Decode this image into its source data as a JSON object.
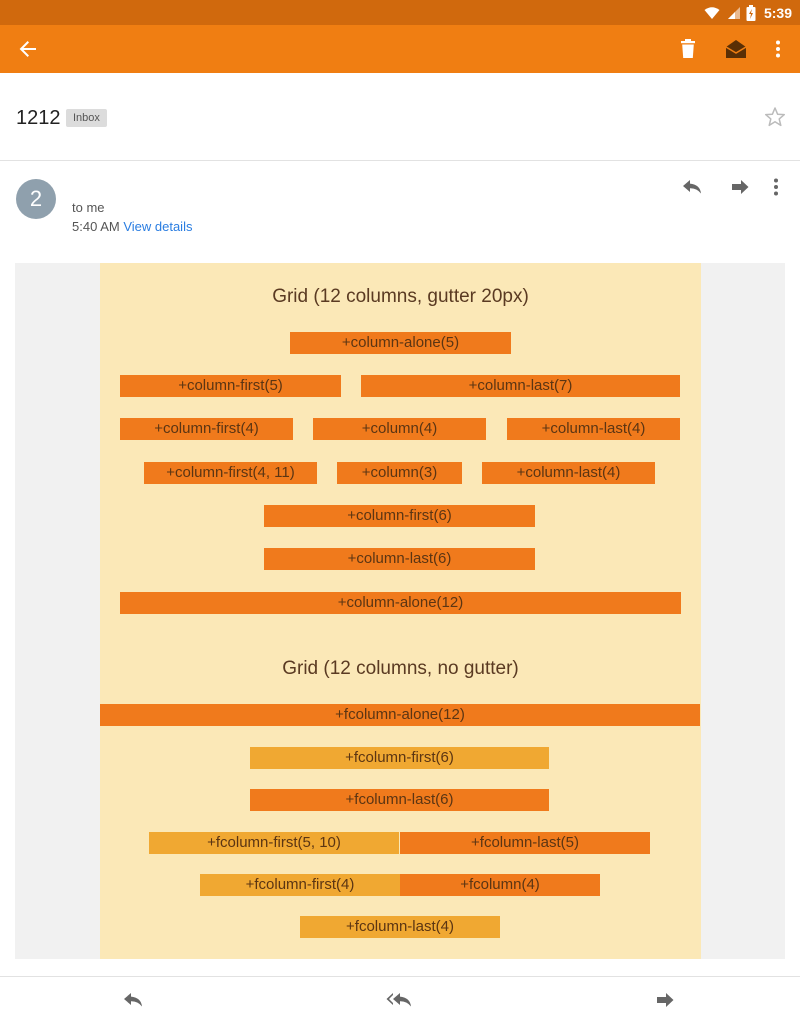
{
  "status_bar": {
    "time": "5:39"
  },
  "app_bar": {
    "back_icon": "arrow-back-icon",
    "delete_icon": "trash-icon",
    "mark_unread_icon": "envelope-open-icon",
    "more_icon": "more-vert-icon"
  },
  "message": {
    "subject": "1212",
    "label": "Inbox",
    "sender_initial": "2",
    "recipient": "to me",
    "time": "5:40 AM",
    "view_details": "View details"
  },
  "email_body": {
    "section1_title": "Grid (12 columns, gutter 20px)",
    "section1_bars": [
      "+column-alone(5)",
      "+column-first(5)",
      "+column-last(7)",
      "+column-first(4)",
      "+column(4)",
      "+column-last(4)",
      "+column-first(4, 11)",
      "+column(3)",
      "+column-last(4)",
      "+column-first(6)",
      "+column-last(6)",
      "+column-alone(12)"
    ],
    "section2_title": "Grid (12 columns, no gutter)",
    "section2_bars": [
      "+fcolumn-alone(12)",
      "+fcolumn-first(6)",
      "+fcolumn-last(6)",
      "+fcolumn-first(5, 10)",
      "+fcolumn-last(5)",
      "+fcolumn-first(4)",
      "+fcolumn(4)",
      "+fcolumn-last(4)"
    ]
  },
  "colors": {
    "status_bar": "#d0690d",
    "app_bar": "#f07e12",
    "bar_dark": "#f07a1c",
    "bar_light": "#f0a832",
    "body_bg": "#fbe8b7",
    "link": "#2a7de1"
  },
  "bottom_actions": {
    "reply_icon": "reply-icon",
    "reply_all_icon": "reply-all-icon",
    "forward_icon": "forward-icon"
  }
}
